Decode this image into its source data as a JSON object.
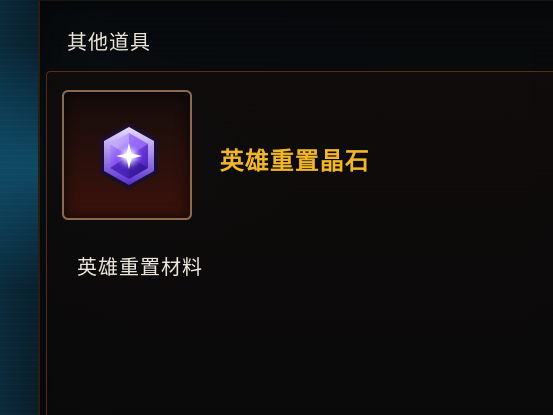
{
  "panel": {
    "title": "其他道具"
  },
  "item": {
    "name": "英雄重置晶石",
    "category": "英雄重置材料",
    "icon": "hero-reset-crystal-icon"
  },
  "colors": {
    "item_name": "#f2b62a",
    "slot_border": "#8b6a52",
    "frame_border": "#5a2a14",
    "gem_purple": "#7a3df0"
  }
}
